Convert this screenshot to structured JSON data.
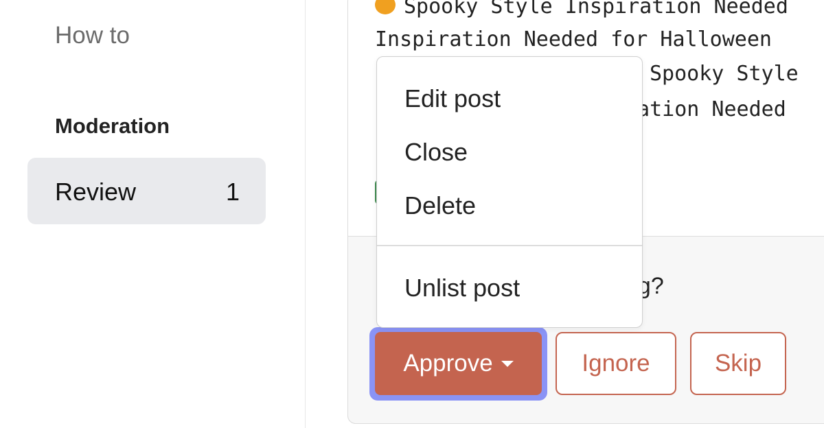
{
  "sidebar": {
    "nav_link": "How to",
    "section_title": "Moderation",
    "review": {
      "label": "Review",
      "count": "1"
    }
  },
  "post": {
    "lines": [
      "Spooky Style Inspiration Needed",
      "Inspiration Needed for Halloween",
      "Spooky Style",
      "ration Needed"
    ],
    "question": "ag?"
  },
  "dropdown": {
    "items": [
      "Edit post",
      "Close",
      "Delete"
    ],
    "extra_item": "Unlist post"
  },
  "actions": {
    "approve_label": "Approve",
    "ignore_label": "Ignore",
    "skip_label": "Skip"
  },
  "colors": {
    "accent": "#c4644f",
    "focus_ring": "#8a93f5",
    "sidebar_active_bg": "#e9eaed"
  }
}
